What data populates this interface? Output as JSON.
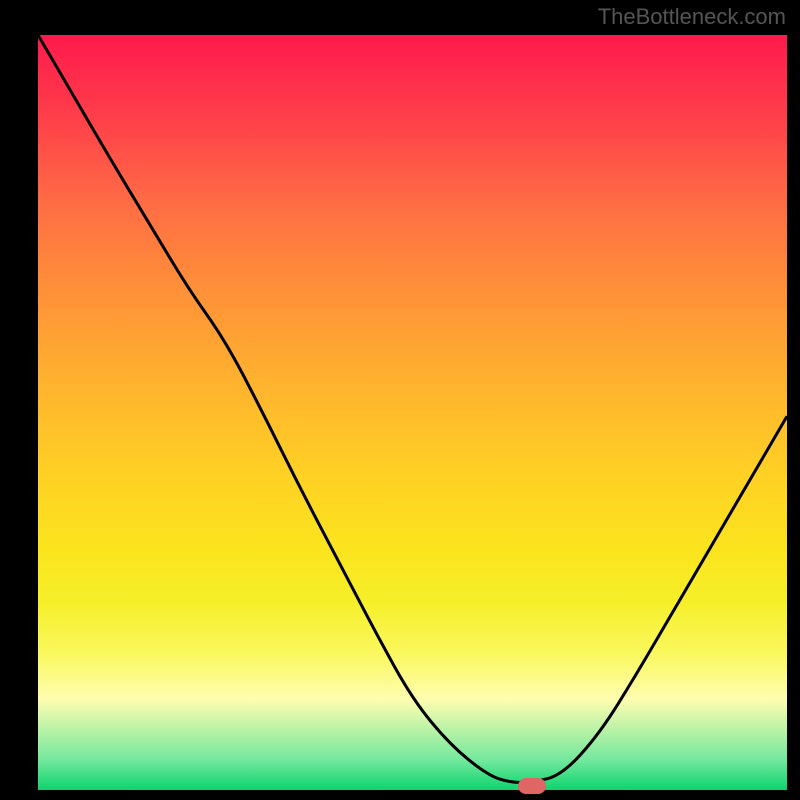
{
  "watermark": "TheBottleneck.com",
  "chart_data": {
    "type": "line",
    "title": "",
    "xlabel": "",
    "ylabel": "",
    "x": [
      0.0,
      0.05,
      0.1,
      0.15,
      0.2,
      0.25,
      0.3,
      0.35,
      0.4,
      0.45,
      0.5,
      0.55,
      0.6,
      0.63,
      0.66,
      0.7,
      0.75,
      0.8,
      0.85,
      0.9,
      0.95,
      1.0
    ],
    "values": [
      1.0,
      0.915,
      0.83,
      0.748,
      0.665,
      0.595,
      0.5,
      0.4,
      0.305,
      0.21,
      0.12,
      0.06,
      0.02,
      0.01,
      0.01,
      0.02,
      0.075,
      0.155,
      0.24,
      0.325,
      0.41,
      0.495
    ],
    "xlim": [
      0,
      1
    ],
    "ylim": [
      0,
      1
    ],
    "marker": {
      "x": 0.66,
      "y": 0.005
    },
    "gradient_stops": [
      {
        "pos": 0.0,
        "color": "#ff1a4d"
      },
      {
        "pos": 0.35,
        "color": "#ff9138"
      },
      {
        "pos": 0.7,
        "color": "#fbe41e"
      },
      {
        "pos": 0.92,
        "color": "#fefdb0"
      },
      {
        "pos": 1.0,
        "color": "#15cf6f"
      }
    ]
  }
}
